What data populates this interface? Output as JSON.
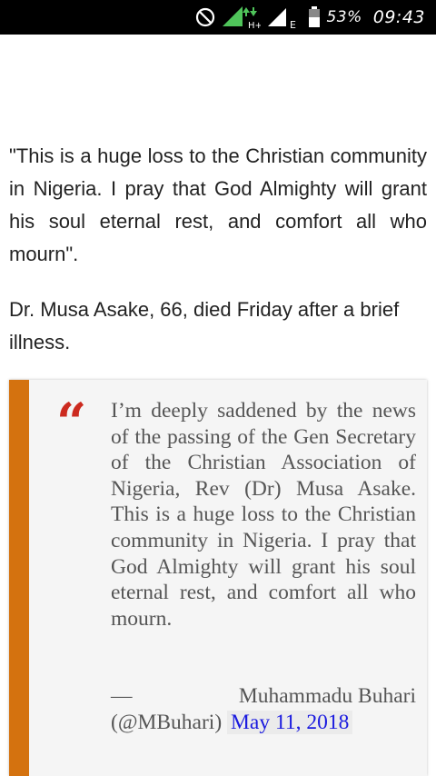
{
  "status_bar": {
    "battery_percent": "53%",
    "time": "09:43",
    "network_type": "E",
    "network_type_2": "H+",
    "icons": [
      "do-not-disturb-icon",
      "signal-h-plus-icon",
      "signal-e-icon",
      "battery-icon"
    ]
  },
  "article": {
    "paragraph1": "\"This is a huge loss to the Christian community in Nigeria. I pray that God Almighty will grant his soul eternal rest, and comfort all who mourn\".",
    "paragraph2": "Dr. Musa Asake, 66, died Friday after a brief illness."
  },
  "quote": {
    "mark": "“",
    "text": "I’m deeply saddened by the news of the passing of the Gen Secretary of the Christian Association of Nigeria, Rev (Dr) Musa Asake. This is a huge loss to the Christian community in Nigeria. I pray that God Almighty will grant his soul eternal rest, and comfort all who mourn.",
    "dash": "—",
    "author": "Muhammadu Buhari",
    "handle": "(@MBuhari)",
    "date": "May 11, 2018"
  },
  "colors": {
    "quote_border": "#d4720f",
    "quote_mark": "#cc2a1f",
    "link": "#1a1adf"
  }
}
